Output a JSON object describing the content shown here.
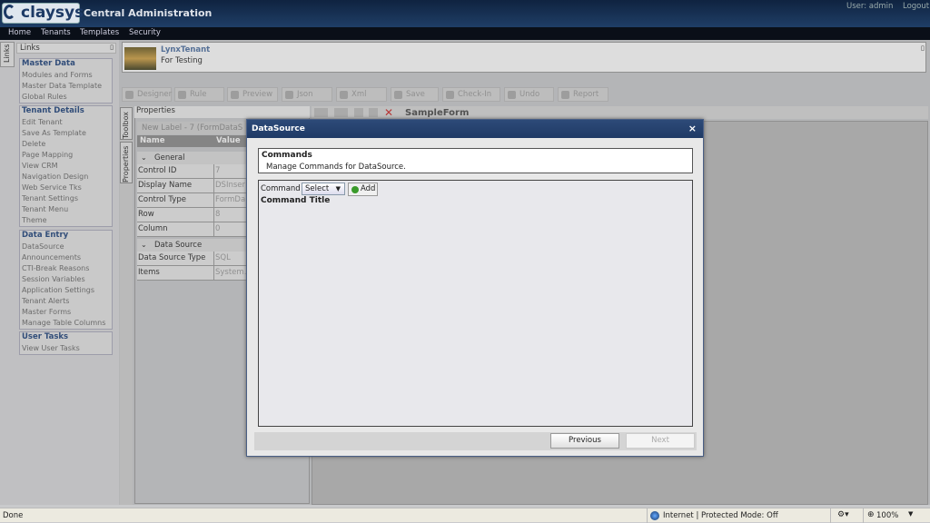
{
  "app": {
    "logo_text": "claysys",
    "title": "Central Administration",
    "user_text": "User: admin",
    "logout": "Logout"
  },
  "menu": [
    "Home",
    "Tenants",
    "Templates",
    "Security"
  ],
  "left_panel": {
    "tab": "Links",
    "header": "Links",
    "groups": [
      {
        "title": "Master Data",
        "items": [
          "Modules and Forms",
          "Master Data Template",
          "Global Rules"
        ]
      },
      {
        "title": "Tenant Details",
        "items": [
          "Edit Tenant",
          "Save As Template",
          "Delete",
          "Page Mapping",
          "View CRM",
          "Navigation Design",
          "Web Service Tks",
          "Tenant Settings",
          "Tenant Menu",
          "Theme"
        ]
      },
      {
        "title": "Data Entry",
        "items": [
          "DataSource",
          "Announcements",
          "CTI-Break Reasons",
          "Session Variables",
          "Application Settings",
          "Tenant Alerts",
          "Master Forms",
          "Manage Table Columns"
        ]
      },
      {
        "title": "User Tasks",
        "items": [
          "View User Tasks"
        ]
      }
    ]
  },
  "tenant": {
    "name": "LynxTenant",
    "description": "For Testing"
  },
  "toolbar": [
    "Designer",
    "Rule",
    "Preview",
    "Json",
    "Xml",
    "Save",
    "Check-In",
    "Undo",
    "Report"
  ],
  "side_tabs": [
    "Toolbox",
    "Properties"
  ],
  "properties": {
    "title": "Properties",
    "label": "New Label - 7 (FormDataS",
    "col_name": "Name",
    "col_value": "Value",
    "sections": [
      {
        "title": "General",
        "rows": [
          {
            "name": "Control ID",
            "value": "7"
          },
          {
            "name": "Display Name",
            "value": "DSInser"
          },
          {
            "name": "Control Type",
            "value": "FormDa"
          },
          {
            "name": "Row",
            "value": "8"
          },
          {
            "name": "Column",
            "value": "0"
          }
        ]
      },
      {
        "title": "Data Source",
        "rows": [
          {
            "name": "Data Source Type",
            "value": "SQL"
          },
          {
            "name": "Items",
            "value": "System."
          }
        ]
      }
    ]
  },
  "form": {
    "name": "SampleForm"
  },
  "dialog": {
    "title": "DataSource",
    "close": "×",
    "commands_title": "Commands",
    "commands_desc": "Manage Commands for DataSource.",
    "command_label": "Command",
    "select_value": "Select",
    "add_label": "Add",
    "command_title_col": "Command Title",
    "previous": "Previous",
    "next": "Next"
  },
  "status": {
    "left": "Done",
    "zone": "Internet | Protected Mode: Off",
    "zoom": "100%"
  }
}
